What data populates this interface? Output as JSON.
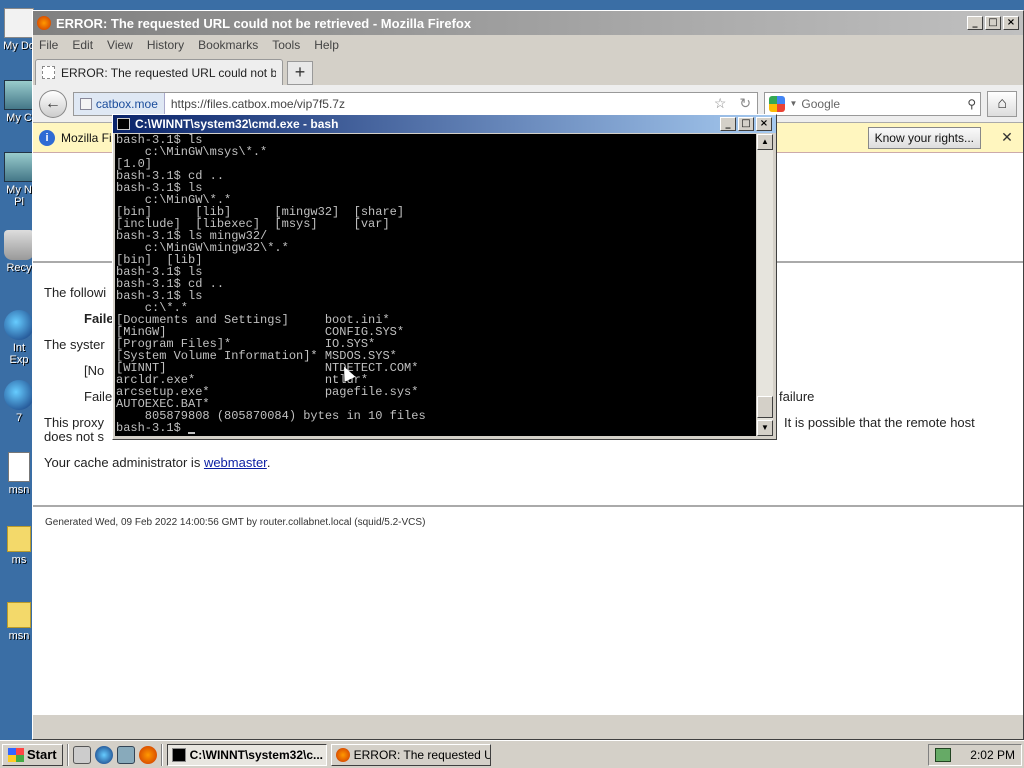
{
  "desktop": {
    "icons": [
      {
        "label": "My Do",
        "icon": "documents-icon"
      },
      {
        "label": "My C",
        "icon": "computer-icon"
      },
      {
        "label": "My N\nPl",
        "icon": "network-icon"
      },
      {
        "label": "Recy",
        "icon": "recycle-bin-icon"
      },
      {
        "label": "Int\nExp",
        "icon": "internet-explorer-icon"
      },
      {
        "label": "7",
        "icon": "globe-icon"
      },
      {
        "label": "msn",
        "icon": "file-icon"
      },
      {
        "label": "ms",
        "icon": "folder-icon"
      },
      {
        "label": "msn",
        "icon": "folder-icon"
      }
    ]
  },
  "firefox": {
    "title": "ERROR: The requested URL could not be retrieved - Mozilla Firefox",
    "menu": [
      "File",
      "Edit",
      "View",
      "History",
      "Bookmarks",
      "Tools",
      "Help"
    ],
    "tab_label": "ERROR: The requested URL could not be ret...",
    "new_tab": "+",
    "identity": "catbox.moe",
    "url": "https://files.catbox.moe/vip7f5.7z",
    "search_placeholder": "Google",
    "notification": "Mozilla Fir",
    "know_rights": "Know your rights...",
    "page": {
      "line1": "The followi",
      "line2": "Faile",
      "line3": "The syster",
      "line4": "[No",
      "line5": "Faile",
      "line5b": "failure",
      "line6a": "This proxy",
      "line6b": "It is possible that the remote host",
      "line7": "does not s",
      "cache_prefix": "Your cache administrator is ",
      "cache_link": "webmaster",
      "cache_suffix": ".",
      "generated": "Generated Wed, 09 Feb 2022 14:00:56 GMT by router.collabnet.local (squid/5.2-VCS)"
    }
  },
  "cmd": {
    "title": "C:\\WINNT\\system32\\cmd.exe - bash",
    "lines": [
      "bash-3.1$ ls",
      "    c:\\MinGW\\msys\\*.*",
      "[1.0]",
      "bash-3.1$ cd ..",
      "bash-3.1$ ls",
      "    c:\\MinGW\\*.*",
      "[bin]      [lib]      [mingw32]  [share]",
      "[include]  [libexec]  [msys]     [var]",
      "bash-3.1$ ls mingw32/",
      "    c:\\MinGW\\mingw32\\*.*",
      "[bin]  [lib]",
      "bash-3.1$ ls",
      "bash-3.1$ cd ..",
      "bash-3.1$ ls",
      "    c:\\*.*",
      "[Documents and Settings]     boot.ini*",
      "[MinGW]                      CONFIG.SYS*",
      "[Program Files]*             IO.SYS*",
      "[System Volume Information]* MSDOS.SYS*",
      "[WINNT]                      NTDETECT.COM*",
      "arcldr.exe*                  ntldr*",
      "arcsetup.exe*                pagefile.sys*",
      "AUTOEXEC.BAT*",
      "    805879808 (805870084) bytes in 10 files",
      "bash-3.1$ "
    ]
  },
  "taskbar": {
    "start": "Start",
    "tasks": [
      {
        "label": "C:\\WINNT\\system32\\c...",
        "active": true
      },
      {
        "label": "ERROR: The requested U...",
        "active": false
      }
    ],
    "clock": "2:02 PM"
  }
}
